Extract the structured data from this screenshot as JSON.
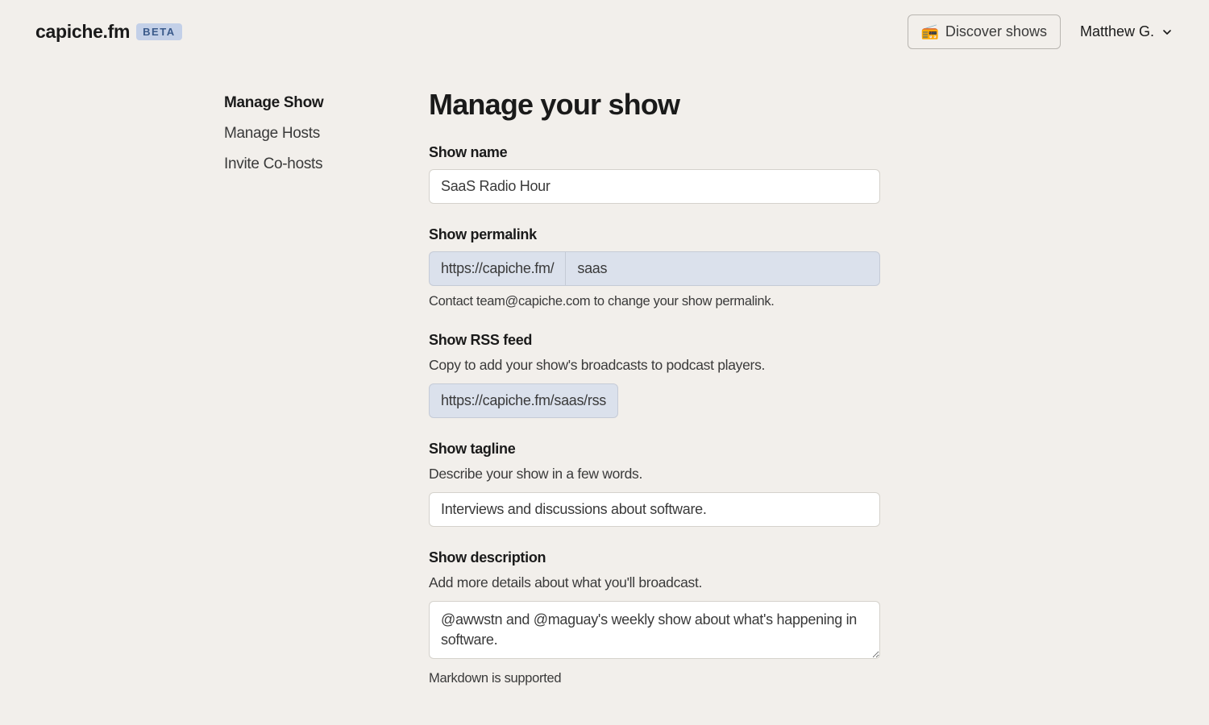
{
  "header": {
    "logo": "capiche.fm",
    "beta_label": "BETA",
    "discover_icon": "📻",
    "discover_label": "Discover shows",
    "user_name": "Matthew G."
  },
  "sidebar": {
    "items": [
      {
        "label": "Manage Show",
        "active": true
      },
      {
        "label": "Manage Hosts",
        "active": false
      },
      {
        "label": "Invite Co-hosts",
        "active": false
      }
    ]
  },
  "main": {
    "title": "Manage your show",
    "show_name": {
      "label": "Show name",
      "value": "SaaS Radio Hour"
    },
    "permalink": {
      "label": "Show permalink",
      "prefix": "https://capiche.fm/",
      "value": "saas",
      "hint": "Contact team@capiche.com to change your show permalink."
    },
    "rss": {
      "label": "Show RSS feed",
      "helper": "Copy to add your show's broadcasts to podcast players.",
      "value": "https://capiche.fm/saas/rss"
    },
    "tagline": {
      "label": "Show tagline",
      "helper": "Describe your show in a few words.",
      "value": "Interviews and discussions about software."
    },
    "description": {
      "label": "Show description",
      "helper": "Add more details about what you'll broadcast.",
      "value": "@awwstn and @maguay's weekly show about what's happening in software.",
      "hint": "Markdown is supported"
    }
  }
}
